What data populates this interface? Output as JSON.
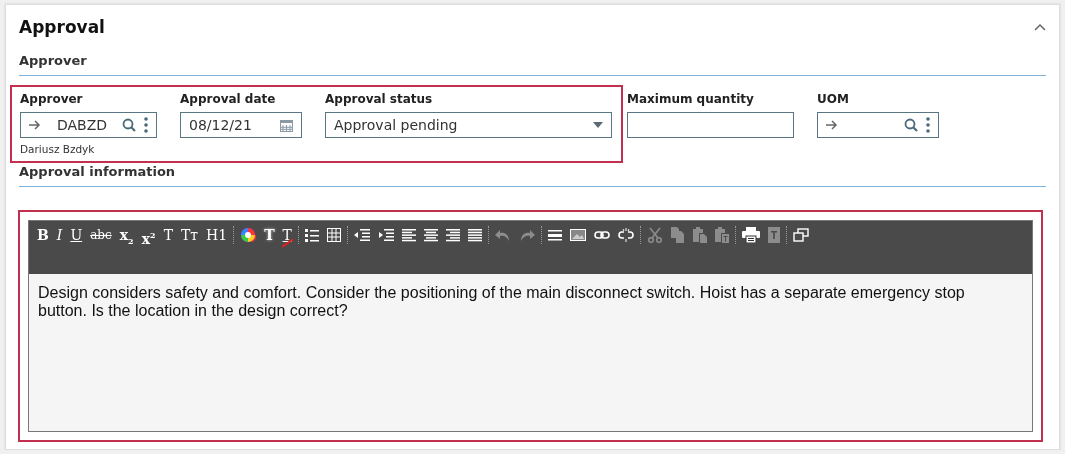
{
  "card": {
    "title": "Approval",
    "expanded": true
  },
  "sections": [
    {
      "title": "Approver"
    },
    {
      "title": "Approval information"
    }
  ],
  "field_groups": [
    {
      "highlighted": true,
      "fields": [
        {
          "label": "Approver",
          "kind": "lookup",
          "value": "DABZD",
          "caption": "Dariusz Bzdyk"
        },
        {
          "label": "Approval date",
          "kind": "date",
          "value": "08/12/21"
        },
        {
          "label": "Approval status",
          "kind": "select",
          "value": "Approval pending"
        }
      ]
    },
    {
      "highlighted": false,
      "fields": [
        {
          "label": "Maximum quantity",
          "kind": "text"
        },
        {
          "label": "UOM",
          "kind": "lookup"
        }
      ]
    }
  ],
  "editor": {
    "highlighted": true,
    "toolbar": [
      {
        "kind": "bold",
        "label": "B",
        "disabled": false
      },
      {
        "kind": "italic",
        "label": "I",
        "disabled": false
      },
      {
        "kind": "underline",
        "label": "U",
        "disabled": false
      },
      {
        "kind": "strike",
        "label": "abc",
        "disabled": false
      },
      {
        "kind": "bold",
        "label": "x$_{2}$",
        "disabled": false
      },
      {
        "kind": "bold",
        "label": "x$^{2}$",
        "disabled": false
      },
      {
        "kind": "plain",
        "label": "T",
        "disabled": false
      },
      {
        "kind": "plain",
        "label": "Tт",
        "disabled": false
      },
      {
        "kind": "plain",
        "label": "H1",
        "disabled": false
      },
      {
        "kind": "separator"
      },
      {
        "kind": "color-wheel",
        "disabled": false
      },
      {
        "kind": "glow",
        "label": "T",
        "disabled": false
      },
      {
        "kind": "slash",
        "label": "T",
        "disabled": false
      },
      {
        "kind": "separator"
      },
      {
        "kind": "bullet-list",
        "disabled": false
      },
      {
        "kind": "table",
        "disabled": false
      },
      {
        "kind": "separator"
      },
      {
        "kind": "outdent",
        "disabled": false
      },
      {
        "kind": "indent",
        "disabled": false
      },
      {
        "kind": "align-left",
        "disabled": false
      },
      {
        "kind": "align-center",
        "disabled": false
      },
      {
        "kind": "align-right",
        "disabled": false
      },
      {
        "kind": "justify",
        "disabled": false
      },
      {
        "kind": "separator"
      },
      {
        "kind": "undo",
        "disabled": true
      },
      {
        "kind": "redo",
        "disabled": true
      },
      {
        "kind": "separator"
      },
      {
        "kind": "horizontal-rule",
        "disabled": false
      },
      {
        "kind": "image",
        "disabled": false
      },
      {
        "kind": "link",
        "disabled": false
      },
      {
        "kind": "unlink",
        "disabled": false
      },
      {
        "kind": "separator"
      },
      {
        "kind": "cut",
        "disabled": true
      },
      {
        "kind": "copy",
        "disabled": true
      },
      {
        "kind": "paste",
        "disabled": true
      },
      {
        "kind": "paste-text",
        "disabled": true
      },
      {
        "kind": "separator"
      },
      {
        "kind": "print",
        "disabled": false
      },
      {
        "kind": "template",
        "disabled": true
      },
      {
        "kind": "separator"
      },
      {
        "kind": "popout",
        "disabled": false
      }
    ],
    "content": "Design considers safety and comfort. Consider the positioning of the main disconnect switch. Hoist has a separate emergency stop button. Is the location in the design correct?"
  }
}
